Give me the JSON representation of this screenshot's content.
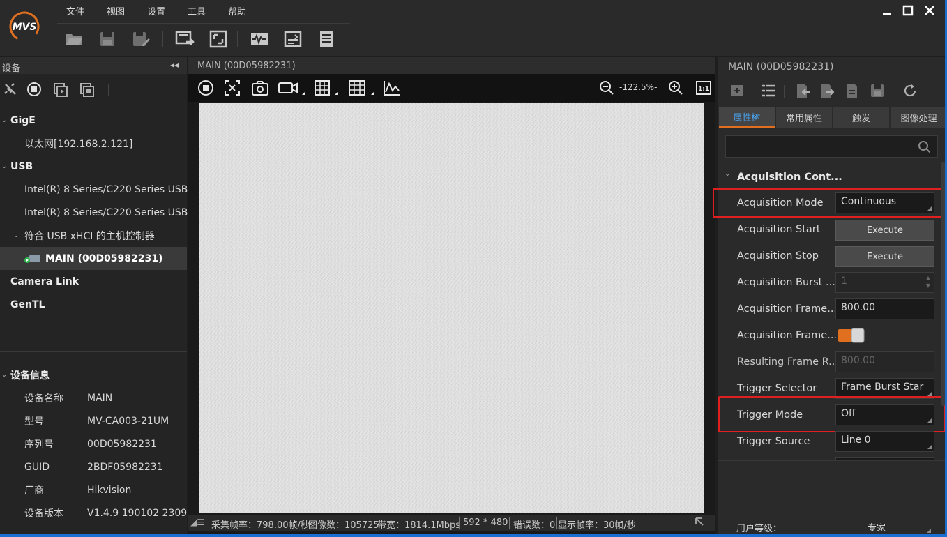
{
  "menu": [
    "文件",
    "视图",
    "设置",
    "工具",
    "帮助"
  ],
  "left": {
    "devices_title": "设备",
    "tree": [
      {
        "label": "GigE",
        "bold": true
      },
      {
        "label": "以太网[192.168.2.121]",
        "bold": false
      },
      {
        "label": "USB",
        "bold": true
      },
      {
        "label": "Intel(R) 8 Series/C220 Series USB...",
        "bold": false
      },
      {
        "label": "Intel(R) 8 Series/C220 Series USB...",
        "bold": false
      },
      {
        "label": "符合 USB xHCI 的主机控制器",
        "bold": false
      },
      {
        "label": "MAIN (00D05982231)",
        "bold": true
      },
      {
        "label": "Camera Link",
        "bold": true
      },
      {
        "label": "GenTL",
        "bold": true
      }
    ],
    "info_title": "设备信息",
    "info": [
      {
        "k": "设备名称",
        "v": "MAIN"
      },
      {
        "k": "型号",
        "v": "MV-CA003-21UM"
      },
      {
        "k": "序列号",
        "v": "00D05982231"
      },
      {
        "k": "GUID",
        "v": "2BDF05982231"
      },
      {
        "k": "厂商",
        "v": "Hikvision"
      },
      {
        "k": "设备版本",
        "v": "V1.4.9 190102 2309..."
      }
    ]
  },
  "center": {
    "title": "MAIN (00D05982231)",
    "zoom": "-122.5%-",
    "status": {
      "fps": "采集帧率：798.00帧/秒",
      "images": "图像数：105725",
      "bandwidth": "带宽：1814.1Mbps",
      "resolution": "592 * 480",
      "errors": "错误数：0",
      "display": "显示帧率：30帧/秒"
    }
  },
  "right": {
    "title": "MAIN (00D05982231)",
    "tabs": [
      "属性树",
      "常用属性",
      "触发",
      "图像处理"
    ],
    "group": "Acquisition Cont...",
    "props": [
      {
        "name": "Acquisition Mode",
        "value": "Continuous",
        "kind": "enum"
      },
      {
        "name": "Acquisition Start",
        "value": "Execute",
        "kind": "button"
      },
      {
        "name": "Acquisition Stop",
        "value": "Execute",
        "kind": "button"
      },
      {
        "name": "Acquisition Burst ...",
        "value": "1",
        "kind": "disabled-spin"
      },
      {
        "name": "Acquisition Frame...",
        "value": "800.00",
        "kind": "text"
      },
      {
        "name": "Acquisition Frame...",
        "value": "",
        "kind": "toggle"
      },
      {
        "name": "Resulting Frame R...",
        "value": "800.00",
        "kind": "disabled"
      },
      {
        "name": "Trigger Selector",
        "value": "Frame Burst Star",
        "kind": "enum"
      },
      {
        "name": "Trigger Mode",
        "value": "Off",
        "kind": "enum"
      },
      {
        "name": "Trigger Source",
        "value": "Line 0",
        "kind": "enum"
      }
    ],
    "user_level_label": "用户等级：",
    "user_level_value": "专家"
  },
  "colors": {
    "accent_orange": "#e07020",
    "highlight_red": "#e02020",
    "tab_active_text": "#4aa3f0"
  }
}
